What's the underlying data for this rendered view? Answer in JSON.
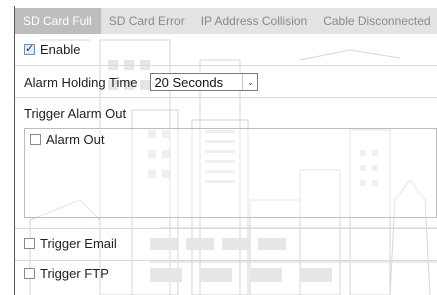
{
  "tabs": [
    {
      "label": "SD Card Full",
      "active": true
    },
    {
      "label": "SD Card Error",
      "active": false
    },
    {
      "label": "IP Address Collision",
      "active": false
    },
    {
      "label": "Cable Disconnected",
      "active": false
    }
  ],
  "enable": {
    "label": "Enable",
    "checked": true
  },
  "alarm_holding_time": {
    "label": "Alarm Holding Time",
    "value": "20 Seconds"
  },
  "trigger_alarm_out": {
    "label": "Trigger Alarm Out",
    "alarm_out_label": "Alarm Out",
    "alarm_out_checked": false
  },
  "trigger_email": {
    "label": "Trigger Email",
    "checked": false
  },
  "trigger_ftp": {
    "label": "Trigger FTP",
    "checked": false
  },
  "colors": {
    "active_tab": "#bdbdbd",
    "tab_bar": "#e3e3e3",
    "watermark": "#d8d8d8"
  }
}
